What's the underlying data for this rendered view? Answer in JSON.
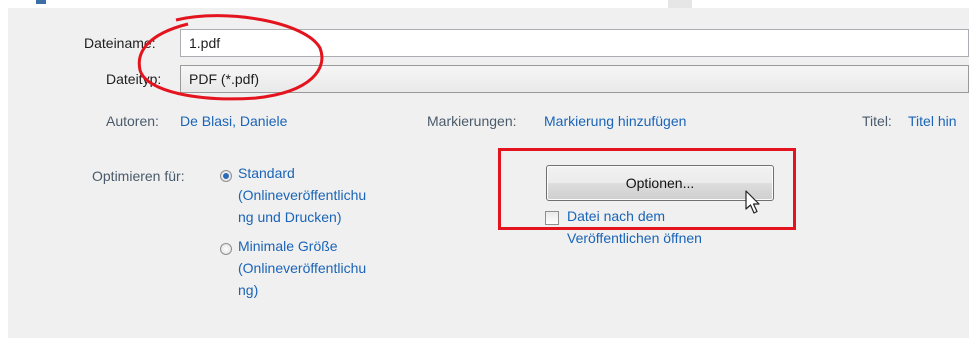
{
  "filename": {
    "label": "Dateiname:",
    "value": "1.pdf"
  },
  "filetype": {
    "label": "Dateityp:",
    "value": "PDF (*.pdf)"
  },
  "meta": {
    "authors_label": "Autoren:",
    "authors_value": "De Blasi, Daniele",
    "tags_label": "Markierungen:",
    "tags_value": "Markierung hinzufügen",
    "title_label": "Titel:",
    "title_value": "Titel hin"
  },
  "optimize": {
    "label": "Optimieren für:",
    "options": [
      {
        "text": "Standard\n(Onlineveröffentlichu\nng und Drucken)",
        "selected": true
      },
      {
        "text": "Minimale Größe\n(Onlineveröffentlichu\nng)",
        "selected": false
      }
    ]
  },
  "options_button": {
    "label": "Optionen..."
  },
  "open_after": {
    "label": "Datei nach dem\nVeröffentlichen öffnen",
    "checked": false
  },
  "annotations": {
    "color": "#e3141e"
  }
}
